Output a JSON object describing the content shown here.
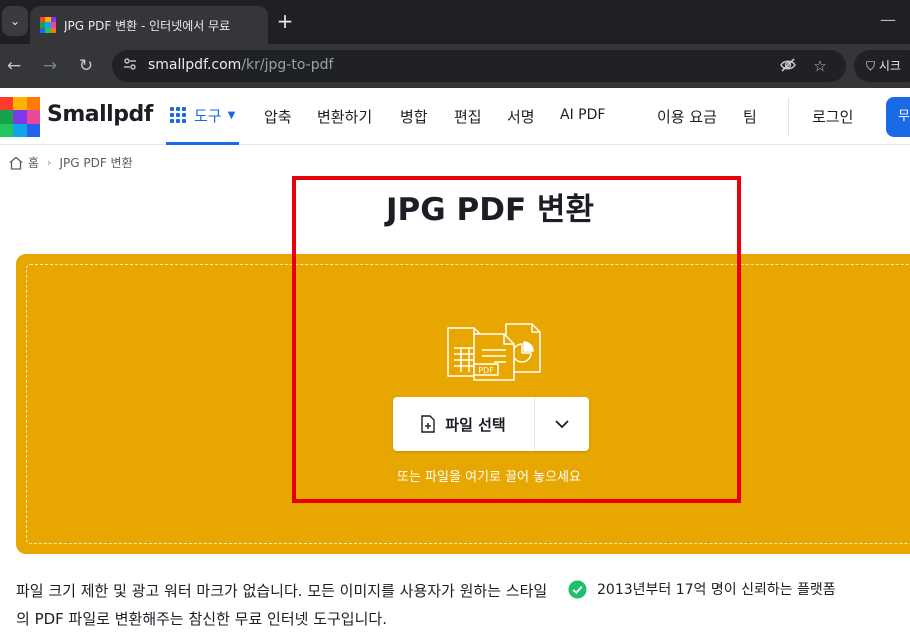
{
  "browser": {
    "tab_title": "JPG PDF 변환 - 인터넷에서 무료",
    "new_tab_symbol": "+",
    "url_host": "smallpdf.com",
    "url_path": "/kr/jpg-to-pdf",
    "profile_label": "시크"
  },
  "site": {
    "logo_text": "Smallpdf",
    "nav": {
      "tools": "도구",
      "compress": "압축",
      "convert": "변환하기",
      "merge": "병합",
      "edit": "편집",
      "sign": "서명",
      "ai_pdf": "AI PDF",
      "pricing": "이용 요금",
      "team": "팀",
      "login": "로그인",
      "cta": "무"
    },
    "brand_colors": [
      "#ff3b30",
      "#ffb000",
      "#7c3aed",
      "#16a34a",
      "#22c55e",
      "#0ea5e9",
      "#2563eb",
      "#ec4899",
      "#f97316"
    ]
  },
  "breadcrumb": {
    "home": "홈",
    "current": "JPG PDF 변환"
  },
  "main": {
    "title": "JPG PDF 변환",
    "file_badge": "PDF",
    "choose_file": "파일 선택",
    "drop_hint": "또는 파일을 여기로 끌어 놓으세요",
    "description": "파일 크기 제한 및 광고 워터 마크가 없습니다. 모든 이미지를 사용자가 원하는 스타일의 PDF 파일로 변환해주는 참신한 무료 인터넷 도구입니다.",
    "trust": "2013년부터 17억 명이 신뢰하는 플랫폼"
  },
  "colors": {
    "dropzone": "#e8a700",
    "accent": "#1a6ae6",
    "annotation": "#e8000b",
    "success": "#1fbf6c"
  }
}
